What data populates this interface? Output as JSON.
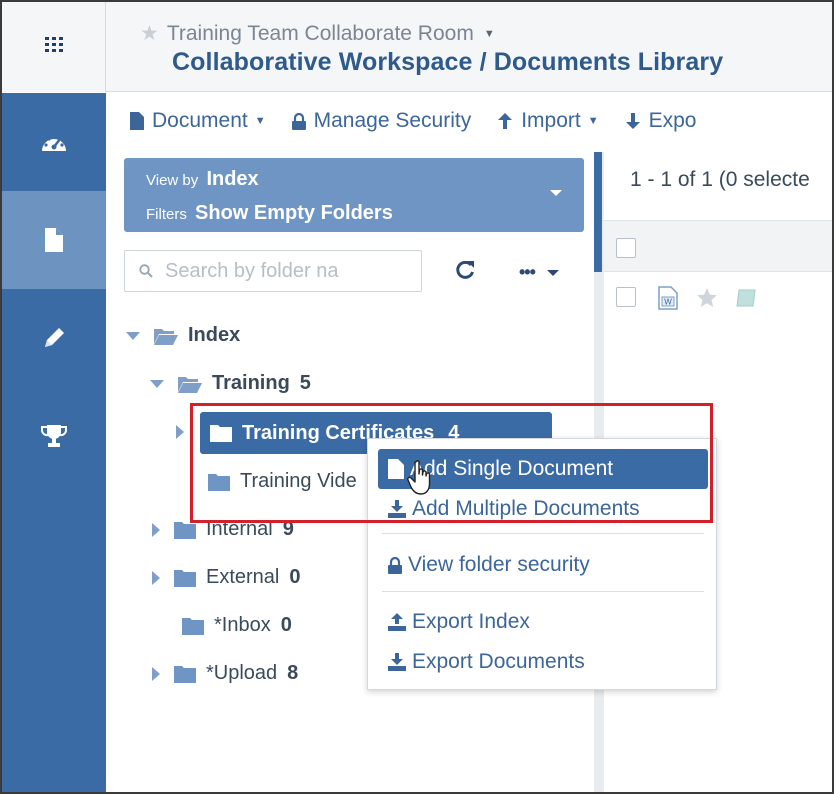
{
  "header": {
    "room_name": "Training Team Collaborate Room",
    "workspace_title": "Collaborative Workspace / Documents Library"
  },
  "leftnav": {
    "items": [
      {
        "icon": "dashboard-gauge-icon"
      },
      {
        "icon": "document-icon",
        "active": true
      },
      {
        "icon": "pencil-icon"
      },
      {
        "icon": "trophy-icon"
      }
    ]
  },
  "toolbar": {
    "document_label": "Document",
    "manage_security_label": "Manage Security",
    "import_label": "Import",
    "export_label": "Expo"
  },
  "viewbox": {
    "view_by_prefix": "View by",
    "view_by_value": "Index",
    "filters_prefix": "Filters",
    "filters_value": "Show Empty Folders"
  },
  "search": {
    "placeholder": "Search by folder na"
  },
  "tree": {
    "root": {
      "label": "Index"
    },
    "training": {
      "label": "Training",
      "count": "5"
    },
    "training_certificates": {
      "label": "Training Certificates",
      "count": "4"
    },
    "training_videos": {
      "label": "Training Vide"
    },
    "internal": {
      "label": "Internal",
      "count": "9"
    },
    "external": {
      "label": "External",
      "count": "0"
    },
    "inbox": {
      "label": "*Inbox",
      "count": "0"
    },
    "upload": {
      "label": "*Upload",
      "count": "8"
    }
  },
  "grid": {
    "pager_text": "1 - 1 of 1 (0 selecte"
  },
  "context_menu": {
    "add_single": "Add Single Document",
    "add_multiple": "Add Multiple Documents",
    "view_security": "View folder security",
    "export_index": "Export Index",
    "export_documents": "Export Documents"
  },
  "colors": {
    "nav_blue": "#3b6ba5",
    "nav_active": "#6d93c1",
    "link_blue": "#3c6699",
    "highlight_red": "#d3202a"
  }
}
